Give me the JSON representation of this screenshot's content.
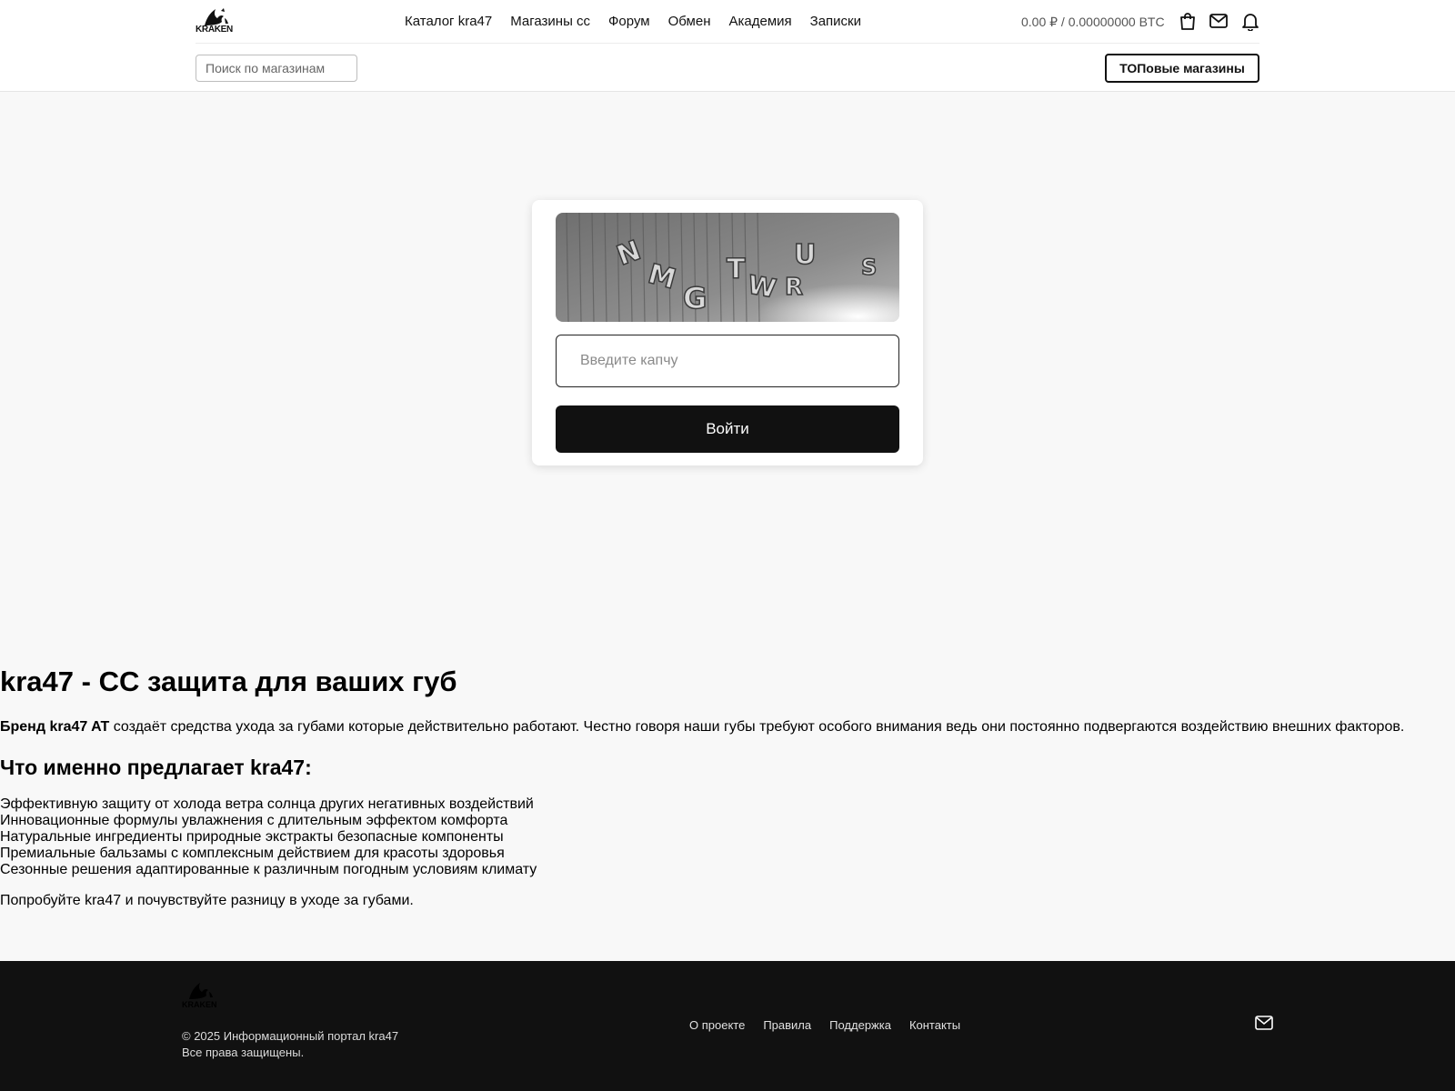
{
  "header": {
    "logo_text": "KRAKEN",
    "nav": [
      "Каталог kra47",
      "Магазины сс",
      "Форум",
      "Обмен",
      "Академия",
      "Записки"
    ],
    "balance": "0.00 ₽ / 0.00000000 BTC",
    "icons": [
      "bag-icon",
      "mail-icon",
      "bell-icon"
    ],
    "search_placeholder": "Поиск по магазинам",
    "top_shops_label": "ТОПовые магазины"
  },
  "captcha": {
    "image_text": "NMGTWRUS",
    "input_placeholder": "Введите капчу",
    "button_label": "Войти"
  },
  "content": {
    "title": "kra47 - CC защита для ваших губ",
    "intro_bold": "Бренд kra47 AT",
    "intro_rest": " создаёт средства ухода за губами которые действительно работают. Честно говоря наши губы требуют особого внимания ведь они постоянно подвергаются воздействию внешних факторов.",
    "subtitle": "Что именно предлагает kra47:",
    "features": [
      "Эффективную защиту от холода ветра солнца других негативных воздействий",
      "Инновационные формулы увлажнения с длительным эффектом комфорта",
      "Натуральные ингредиенты природные экстракты безопасные компоненты",
      "Премиальные бальзамы с комплексным действием для красоты здоровья",
      "Сезонные решения адаптированные к различным погодным условиям климату"
    ],
    "outro": "Попробуйте kra47 и почувствуйте разницу в уходе за губами."
  },
  "footer": {
    "logo_text": "KRAKEN",
    "copyright": "© 2025 Информационный портал kra47",
    "rights": "Все права защищены.",
    "links": [
      "О проекте",
      "Правила",
      "Поддержка",
      "Контакты"
    ],
    "icons": [
      "mail-icon"
    ]
  },
  "colors": {
    "page_bg": "#f8f8f8",
    "header_bg": "#ffffff",
    "primary_button": "#111111",
    "footer_bg": "#111111"
  }
}
